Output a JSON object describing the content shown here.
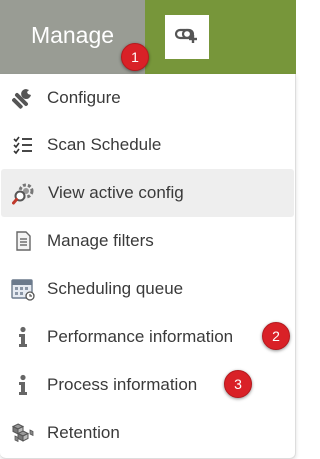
{
  "toolbar": {
    "manage_label": "Manage",
    "link_button_icon": "add-link-icon"
  },
  "badges": {
    "b1": "1",
    "b2": "2",
    "b3": "3"
  },
  "menu": {
    "items": [
      {
        "label": "Configure",
        "icon": "wrench-icon"
      },
      {
        "label": "Scan Schedule",
        "icon": "checklist-icon"
      },
      {
        "label": "View active config",
        "icon": "gear-magnifier-icon"
      },
      {
        "label": "Manage filters",
        "icon": "document-icon"
      },
      {
        "label": "Scheduling queue",
        "icon": "calendar-icon"
      },
      {
        "label": "Performance information",
        "icon": "info-icon"
      },
      {
        "label": "Process information",
        "icon": "info-icon"
      },
      {
        "label": "Retention",
        "icon": "boxes-icon"
      }
    ]
  },
  "colors": {
    "topbar": "#77963a",
    "manage_tab": "#999c94",
    "badge": "#d92127",
    "active_item": "#eeeeee"
  }
}
